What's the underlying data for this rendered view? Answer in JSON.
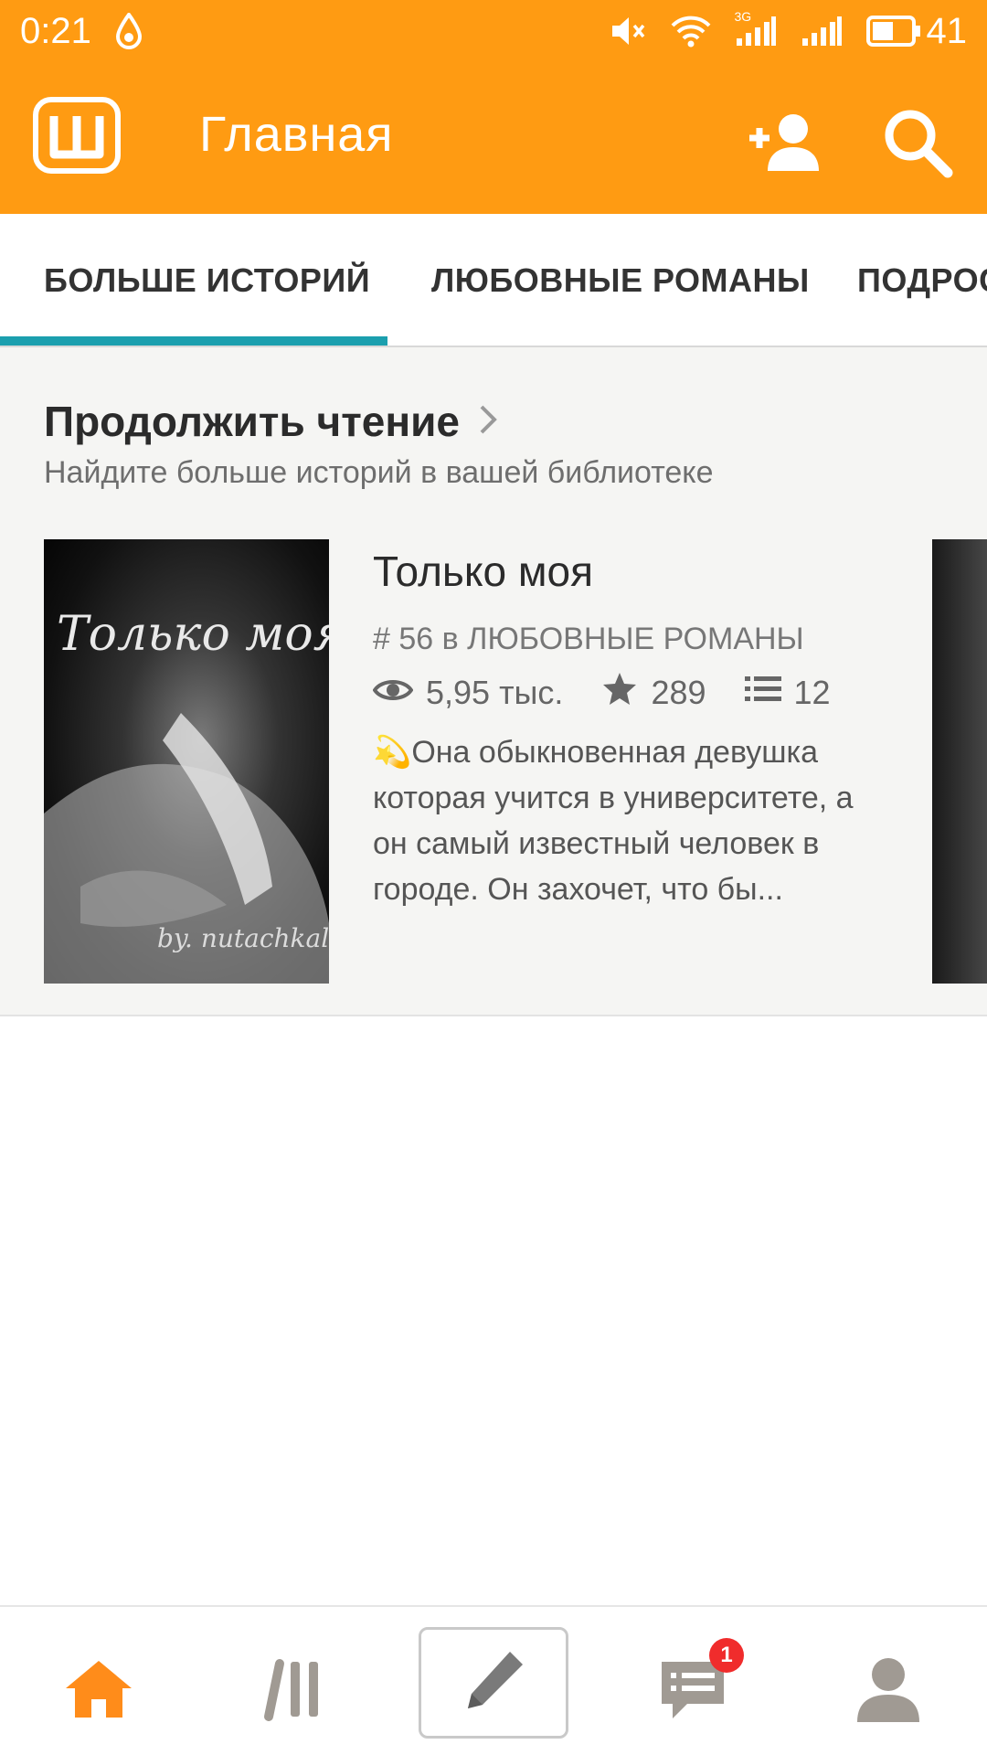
{
  "status_bar": {
    "time": "0:21",
    "network": "3G",
    "battery": "41"
  },
  "app_bar": {
    "title": "Главная"
  },
  "tabs": [
    {
      "label": "БОЛЬШЕ ИСТОРИЙ",
      "active": true
    },
    {
      "label": "ЛЮБОВНЫЕ РОМАНЫ",
      "active": false
    },
    {
      "label": "ПОДРОС",
      "active": false
    }
  ],
  "section": {
    "title": "Продолжить чтение",
    "subtitle": "Найдите больше историй в вашей библиотеке"
  },
  "story": {
    "title": "Только моя",
    "cover_title": "Только моя",
    "cover_author": "by. nutachkal",
    "rank": "# 56 в ЛЮБОВНЫЕ РОМАНЫ",
    "views": "5,95 тыс.",
    "votes": "289",
    "parts": "12",
    "description": "💫Она обыкновенная девушка которая учится в университете, а он самый известный человек в городе. Он захочет, что  бы..."
  },
  "bottom_nav": {
    "messages_badge": "1"
  },
  "colors": {
    "brand": "#ff9b12",
    "tab_indicator": "#1b9fae",
    "home_active": "#ff8c1a",
    "nav_inactive": "#a09a93",
    "badge": "#f02c2c"
  }
}
